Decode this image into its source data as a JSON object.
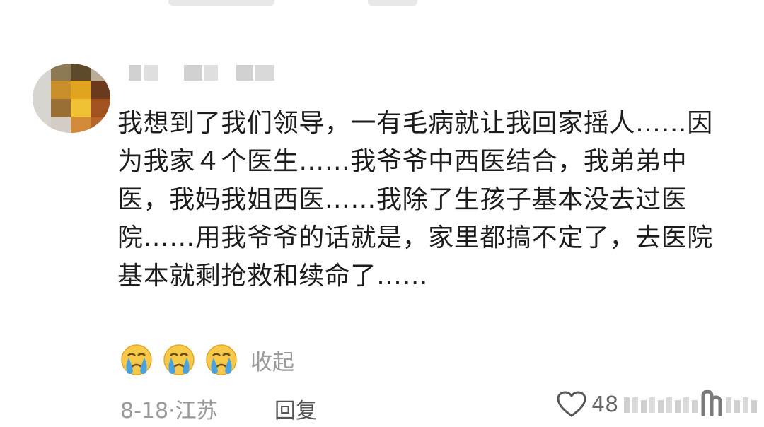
{
  "comment": {
    "text": "我想到了我们领导，一有毛病就让我回家摇人……因为我家４个医生……我爷爷中西医结合，我弟弟中医，我妈我姐西医……我除了生孩子基本没去过医院……用我爷爷的话就是，家里都搞不定了，去医院基本就剩抢救和续命了……",
    "emojis": [
      "crying-face-icon",
      "crying-face-icon",
      "crying-face-icon"
    ],
    "collapse_label": "收起"
  },
  "meta": {
    "date": "8-18",
    "separator": "·",
    "location": "江苏",
    "reply_label": "回复",
    "like_count": "48"
  },
  "colors": {
    "text": "#1c1c1c",
    "muted": "#9a9a9a",
    "emoji_face": "#f7c948",
    "emoji_tear": "#4aa3df"
  }
}
